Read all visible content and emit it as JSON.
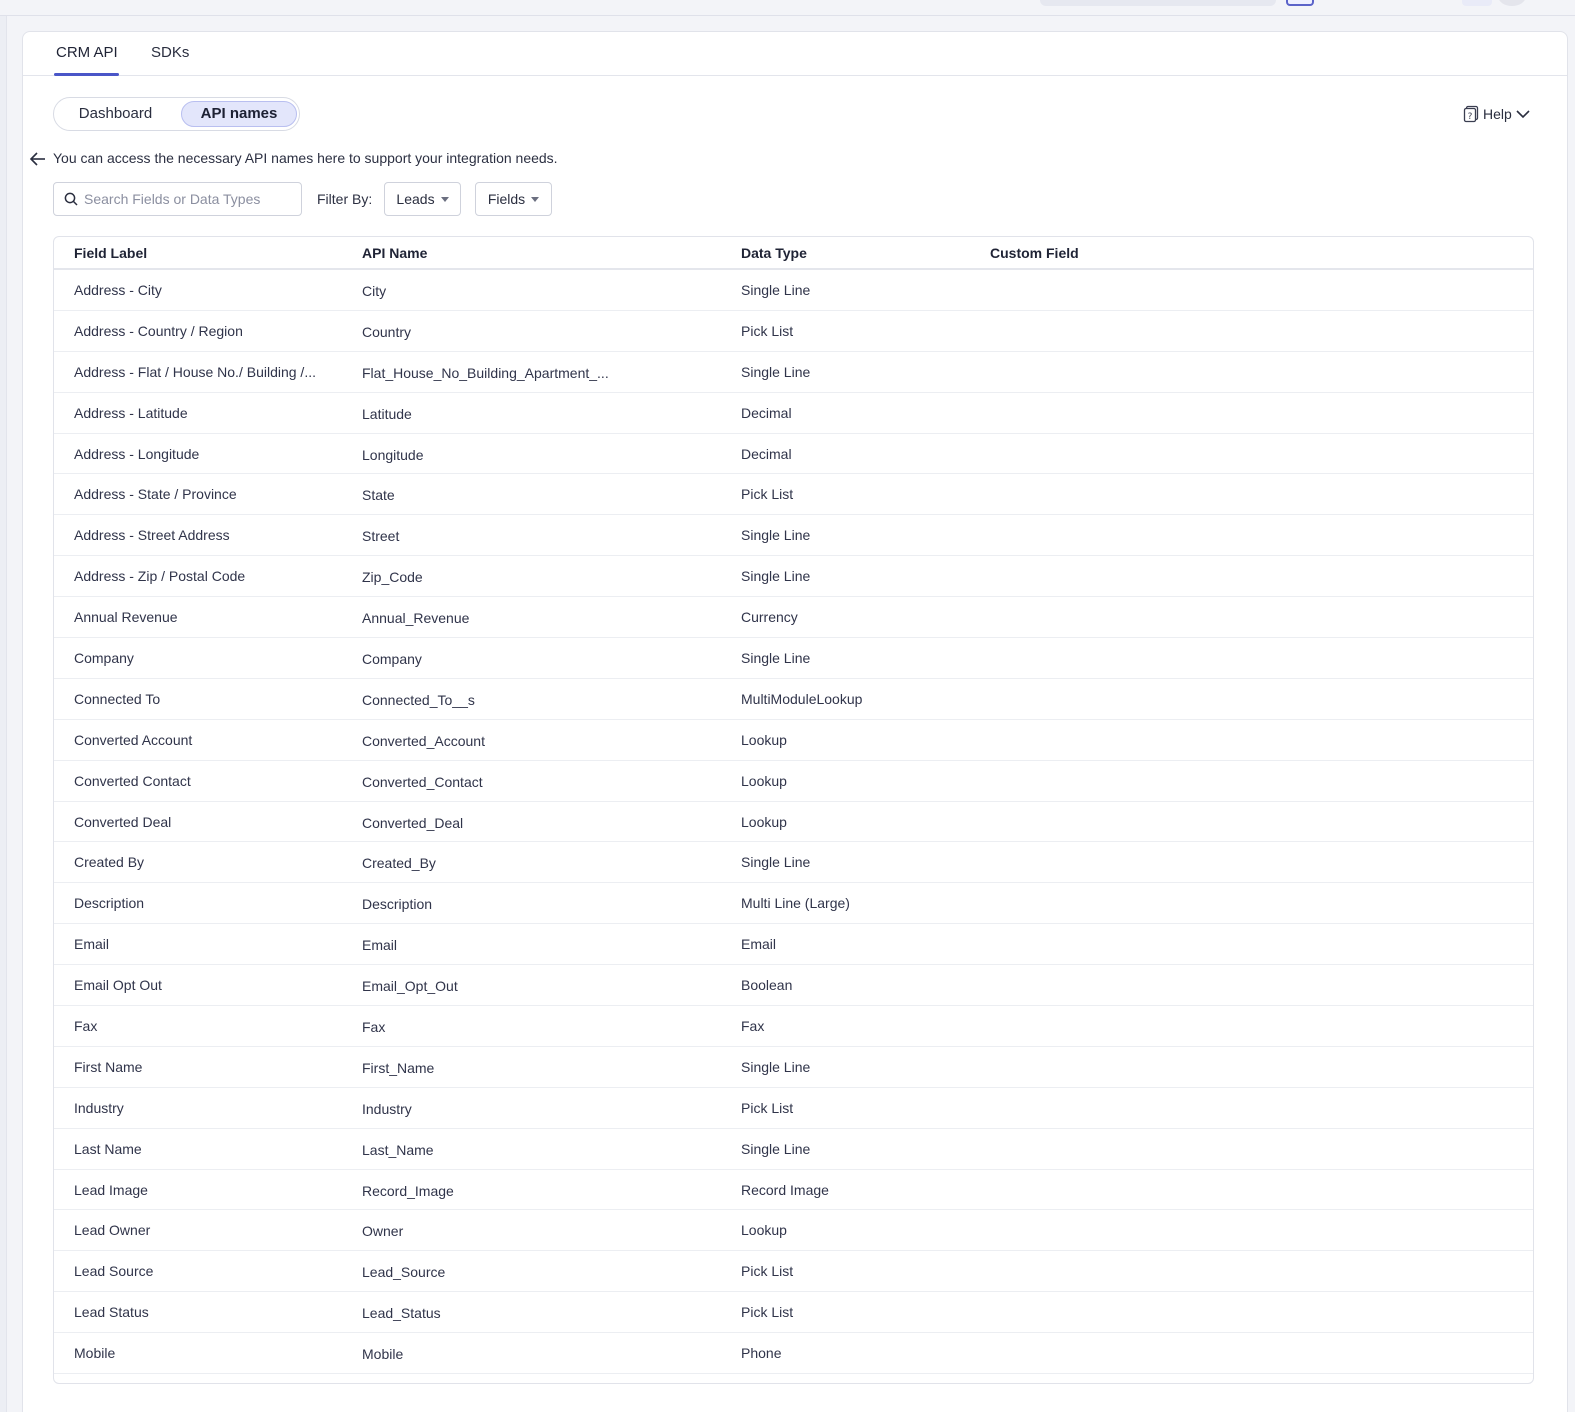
{
  "tabs": [
    "CRM API",
    "SDKs"
  ],
  "views": {
    "dashboard": "Dashboard",
    "api_names": "API names"
  },
  "help_label": "Help",
  "intro_text": "You can access the necessary API names here to support your integration needs.",
  "search": {
    "placeholder": "Search Fields or Data Types",
    "value": ""
  },
  "filter": {
    "label": "Filter By:",
    "module": "Leads",
    "type": "Fields"
  },
  "columns": [
    "Field Label",
    "API Name",
    "Data Type",
    "Custom Field"
  ],
  "rows": [
    [
      "Address - City",
      "City",
      "Single Line",
      ""
    ],
    [
      "Address - Country / Region",
      "Country",
      "Pick List",
      ""
    ],
    [
      "Address - Flat / House No./ Building /...",
      "Flat_House_No_Building_Apartment_...",
      "Single Line",
      ""
    ],
    [
      "Address - Latitude",
      "Latitude",
      "Decimal",
      ""
    ],
    [
      "Address - Longitude",
      "Longitude",
      "Decimal",
      ""
    ],
    [
      "Address - State / Province",
      "State",
      "Pick List",
      ""
    ],
    [
      "Address - Street Address",
      "Street",
      "Single Line",
      ""
    ],
    [
      "Address - Zip / Postal Code",
      "Zip_Code",
      "Single Line",
      ""
    ],
    [
      "Annual Revenue",
      "Annual_Revenue",
      "Currency",
      ""
    ],
    [
      "Company",
      "Company",
      "Single Line",
      ""
    ],
    [
      "Connected To",
      "Connected_To__s",
      "MultiModuleLookup",
      ""
    ],
    [
      "Converted Account",
      "Converted_Account",
      "Lookup",
      ""
    ],
    [
      "Converted Contact",
      "Converted_Contact",
      "Lookup",
      ""
    ],
    [
      "Converted Deal",
      "Converted_Deal",
      "Lookup",
      ""
    ],
    [
      "Created By",
      "Created_By",
      "Single Line",
      ""
    ],
    [
      "Description",
      "Description",
      "Multi Line (Large)",
      ""
    ],
    [
      "Email",
      "Email",
      "Email",
      ""
    ],
    [
      "Email Opt Out",
      "Email_Opt_Out",
      "Boolean",
      ""
    ],
    [
      "Fax",
      "Fax",
      "Fax",
      ""
    ],
    [
      "First Name",
      "First_Name",
      "Single Line",
      ""
    ],
    [
      "Industry",
      "Industry",
      "Pick List",
      ""
    ],
    [
      "Last Name",
      "Last_Name",
      "Single Line",
      ""
    ],
    [
      "Lead Image",
      "Record_Image",
      "Record Image",
      ""
    ],
    [
      "Lead Owner",
      "Owner",
      "Lookup",
      ""
    ],
    [
      "Lead Source",
      "Lead_Source",
      "Pick List",
      ""
    ],
    [
      "Lead Status",
      "Lead_Status",
      "Pick List",
      ""
    ],
    [
      "Mobile",
      "Mobile",
      "Phone",
      ""
    ]
  ],
  "colors": {
    "accent": "#4a56c8",
    "selected_bg": "#e3e6fb",
    "border": "#e1e3ea"
  }
}
